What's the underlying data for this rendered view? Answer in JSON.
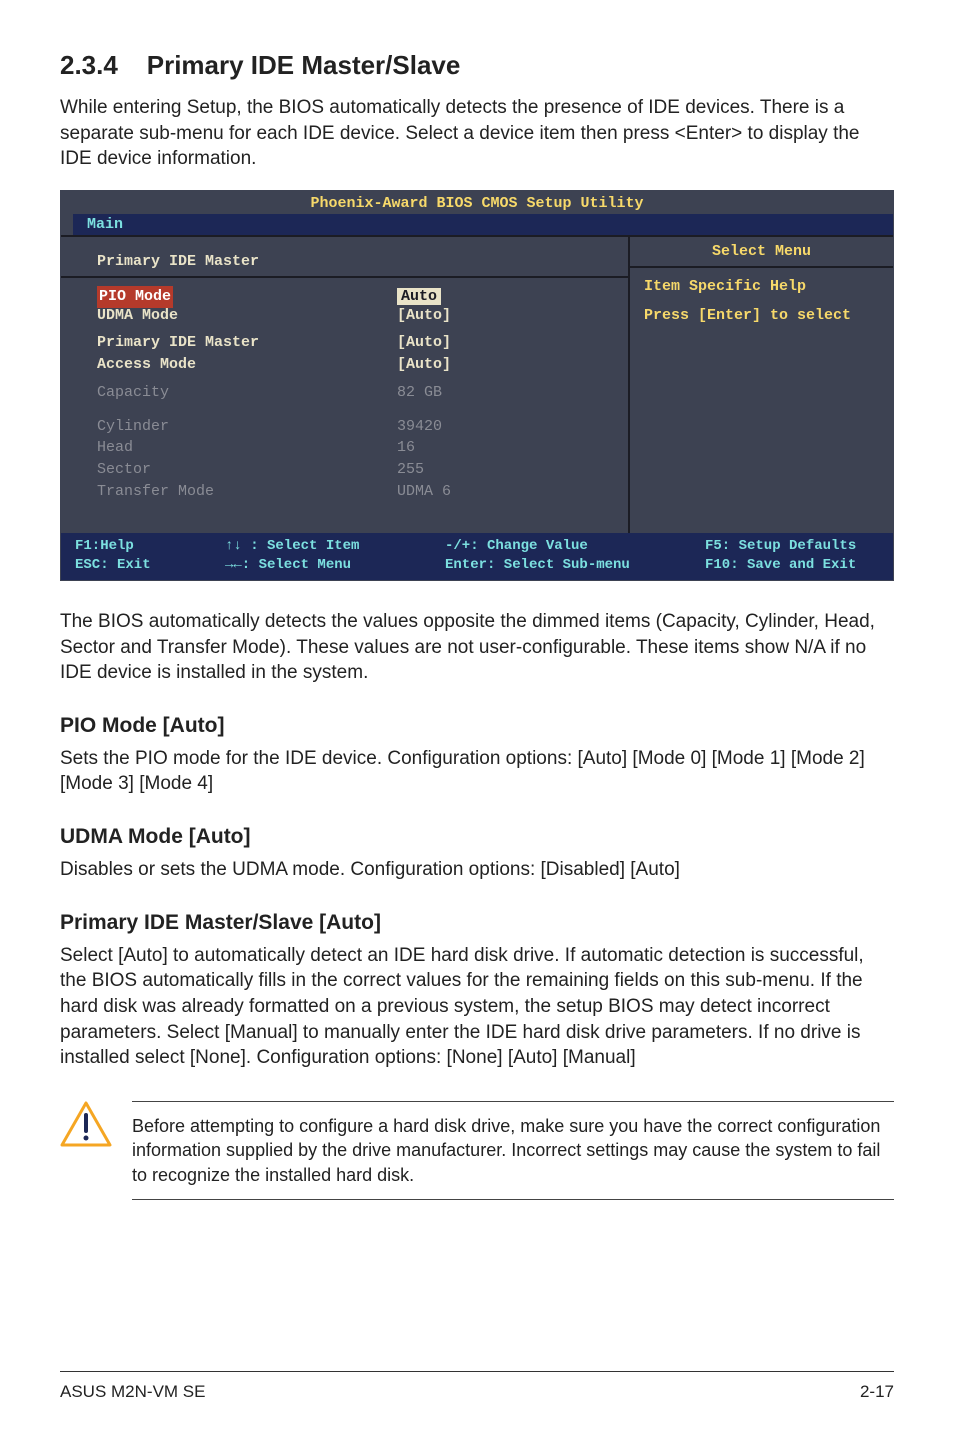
{
  "section": {
    "number": "2.3.4",
    "title": "Primary IDE Master/Slave",
    "intro": "While entering Setup, the BIOS automatically detects the presence of IDE devices. There is a separate sub-menu for each IDE device. Select a device item then press <Enter> to display the IDE device information."
  },
  "bios": {
    "title": "Phoenix-Award BIOS CMOS Setup Utility",
    "tab": "Main",
    "left_header": "Primary IDE Master",
    "right_header": "Select Menu",
    "right_body_line1": "Item Specific Help",
    "right_body_line2": "Press [Enter] to select",
    "rows": {
      "pio_mode": {
        "label": "PIO Mode",
        "value": "Auto"
      },
      "udma_mode": {
        "label": "UDMA Mode",
        "value": "[Auto]"
      },
      "primary_ide_master": {
        "label": "Primary IDE Master",
        "value": "[Auto]"
      },
      "access_mode": {
        "label": "Access Mode",
        "value": "[Auto]"
      },
      "capacity": {
        "label": "Capacity",
        "value": "82 GB"
      },
      "cylinder": {
        "label": "Cylinder",
        "value": "39420"
      },
      "head": {
        "label": "Head",
        "value": "16"
      },
      "sector": {
        "label": "Sector",
        "value": "255"
      },
      "transfer_mode": {
        "label": "Transfer Mode",
        "value": "UDMA 6"
      }
    },
    "footer": {
      "f1": "F1:Help",
      "esc": "ESC: Exit",
      "select_item": "↑↓ : Select Item",
      "select_menu": "→←: Select Menu",
      "change_value": "-/+: Change Value",
      "sub_menu": "Enter: Select Sub-menu",
      "setup_defaults": "F5: Setup Defaults",
      "save_exit": "F10: Save and Exit"
    }
  },
  "after_bios": "The BIOS automatically detects the values opposite the dimmed items (Capacity, Cylinder,  Head, Sector and Transfer Mode). These values are not user-configurable. These items show N/A if no IDE device is installed in the system.",
  "pio": {
    "heading": "PIO Mode [Auto]",
    "body": "Sets the PIO mode for the IDE device. Configuration options: [Auto] [Mode 0] [Mode 1] [Mode 2] [Mode 3] [Mode 4]"
  },
  "udma": {
    "heading": "UDMA Mode [Auto]",
    "body": "Disables or sets the UDMA mode. Configuration options: [Disabled] [Auto]"
  },
  "primary": {
    "heading": "Primary IDE Master/Slave [Auto]",
    "body": "Select [Auto] to automatically detect an IDE hard disk drive. If automatic detection is successful, the BIOS automatically fills in the correct values for the remaining fields on this sub-menu. If the hard disk was already formatted on a previous system, the setup BIOS may detect incorrect parameters. Select [Manual] to manually enter the IDE hard disk drive parameters. If no drive is installed select [None]. Configuration options: [None] [Auto] [Manual]"
  },
  "note": "Before attempting to configure a hard disk drive, make sure you have the correct configuration information supplied by the drive manufacturer. Incorrect settings may cause the system to fail to recognize the installed hard disk.",
  "footer": {
    "product": "ASUS M2N-VM SE",
    "page": "2-17"
  }
}
